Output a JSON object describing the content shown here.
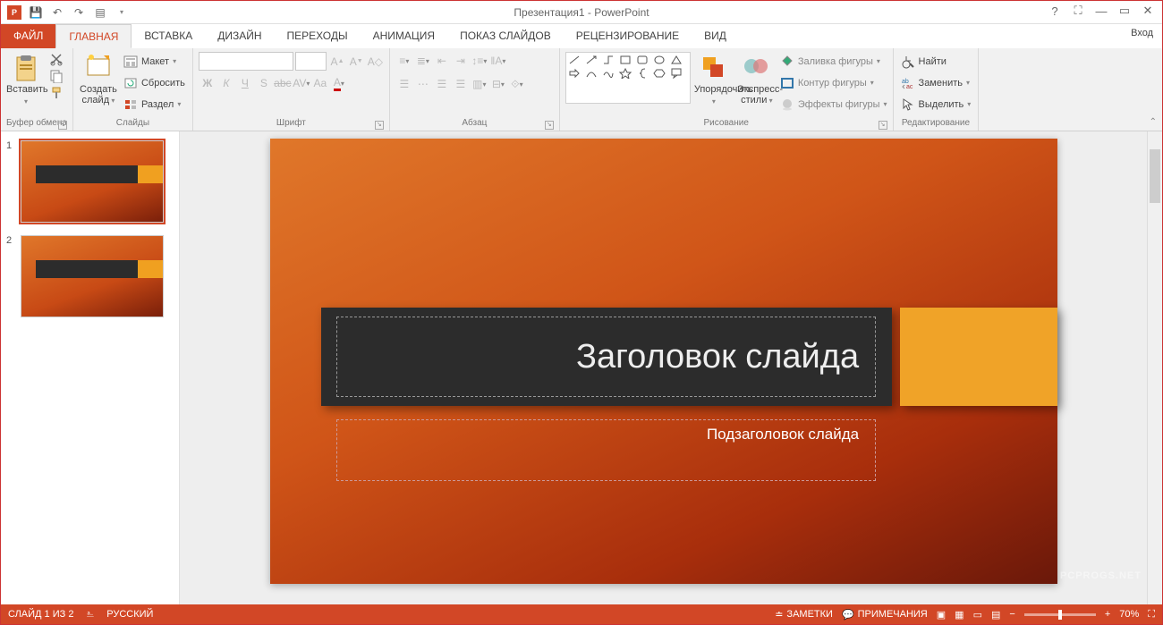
{
  "title": "Презентация1 - PowerPoint",
  "signin": "Вход",
  "tabs": {
    "file": "ФАЙЛ",
    "home": "ГЛАВНАЯ",
    "insert": "ВСТАВКА",
    "design": "ДИЗАЙН",
    "transitions": "ПЕРЕХОДЫ",
    "animations": "АНИМАЦИЯ",
    "slideshow": "ПОКАЗ СЛАЙДОВ",
    "review": "РЕЦЕНЗИРОВАНИЕ",
    "view": "ВИД"
  },
  "groups": {
    "clipboard": {
      "label": "Буфер обмена",
      "paste": "Вставить"
    },
    "slides": {
      "label": "Слайды",
      "new": "Создать слайд",
      "layout": "Макет",
      "reset": "Сбросить",
      "section": "Раздел"
    },
    "font": {
      "label": "Шрифт"
    },
    "paragraph": {
      "label": "Абзац"
    },
    "drawing": {
      "label": "Рисование",
      "arrange": "Упорядочить",
      "styles": "Экспресс-стили",
      "fill": "Заливка фигуры",
      "outline": "Контур фигуры",
      "effects": "Эффекты фигуры"
    },
    "editing": {
      "label": "Редактирование",
      "find": "Найти",
      "replace": "Заменить",
      "select": "Выделить"
    }
  },
  "slide": {
    "title_ph": "Заголовок слайда",
    "subtitle_ph": "Подзаголовок слайда"
  },
  "thumbs": {
    "n1": "1",
    "n2": "2"
  },
  "status": {
    "slide": "СЛАЙД 1 ИЗ 2",
    "lang": "РУССКИЙ",
    "notes": "ЗАМЕТКИ",
    "comments": "ПРИМЕЧАНИЯ",
    "zoom": "70%"
  },
  "watermark": "PCPROGS.NET"
}
